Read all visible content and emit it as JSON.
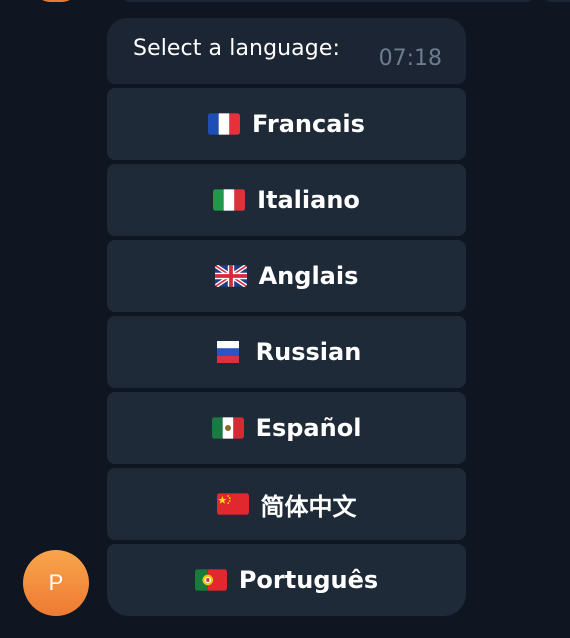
{
  "message": {
    "text": "Select a language:",
    "time": "07:18"
  },
  "keyboard": {
    "buttons": [
      {
        "label": "Francais",
        "flag_icon": "france-flag-icon"
      },
      {
        "label": "Italiano",
        "flag_icon": "italy-flag-icon"
      },
      {
        "label": "Anglais",
        "flag_icon": "uk-flag-icon"
      },
      {
        "label": "Russian",
        "flag_icon": "russia-flag-icon"
      },
      {
        "label": "Español",
        "flag_icon": "mexico-flag-icon"
      },
      {
        "label": "简体中文",
        "flag_icon": "china-flag-icon"
      },
      {
        "label": "Português",
        "flag_icon": "portugal-flag-icon"
      }
    ]
  },
  "sender": {
    "avatar_initial": "P",
    "avatar_color": "#f29242"
  },
  "colors": {
    "background": "#0f1621",
    "bubble": "#1b2533",
    "button": "#1e2a38",
    "time": "#6d7d8d"
  }
}
